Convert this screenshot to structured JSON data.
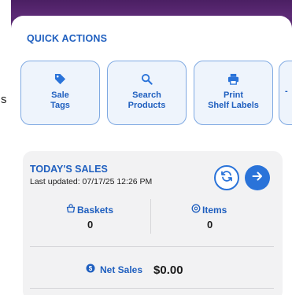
{
  "quick_actions": {
    "title": "QUICK ACTIONS",
    "items": [
      {
        "line1": "Sale",
        "line2": "Tags",
        "icon": "tag-icon"
      },
      {
        "line1": "Search",
        "line2": "Products",
        "icon": "search-icon"
      },
      {
        "line1": "Print",
        "line2": "Shelf Labels",
        "icon": "printer-icon"
      }
    ]
  },
  "todays_sales": {
    "title": "TODAY'S SALES",
    "last_updated": "Last updated: 07/17/25 12:26 PM",
    "baskets_label": "Baskets",
    "baskets_value": "0",
    "items_label": "Items",
    "items_value": "0",
    "net_sales_label": "Net Sales",
    "net_sales_value": "$0.00"
  },
  "colors": {
    "accent": "#2a73d9",
    "title_blue": "#1f5fbf",
    "header_purple": "#5a2a73",
    "card_fill": "#eef4fc",
    "panel_fill": "#f2f2f3"
  }
}
